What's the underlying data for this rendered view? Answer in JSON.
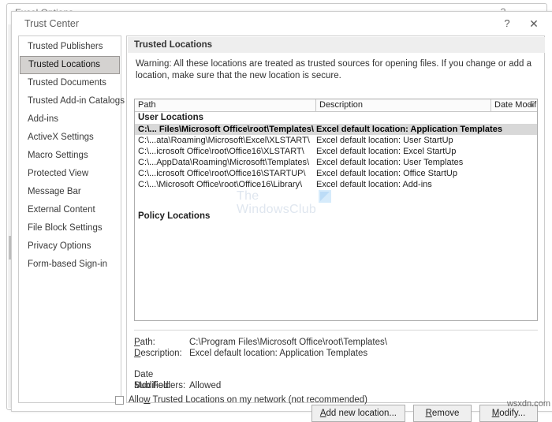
{
  "background_window": {
    "title": "Excel Options",
    "help_icon": "?",
    "minimize_icon": "⌄"
  },
  "dialog": {
    "title": "Trust Center",
    "help_icon": "?",
    "close_icon": "✕"
  },
  "sidebar": {
    "items": [
      {
        "label": "Trusted Publishers",
        "selected": false
      },
      {
        "label": "Trusted Locations",
        "selected": true
      },
      {
        "label": "Trusted Documents",
        "selected": false
      },
      {
        "label": "Trusted Add-in Catalogs",
        "selected": false
      },
      {
        "label": "Add-ins",
        "selected": false
      },
      {
        "label": "ActiveX Settings",
        "selected": false
      },
      {
        "label": "Macro Settings",
        "selected": false
      },
      {
        "label": "Protected View",
        "selected": false
      },
      {
        "label": "Message Bar",
        "selected": false
      },
      {
        "label": "External Content",
        "selected": false
      },
      {
        "label": "File Block Settings",
        "selected": false
      },
      {
        "label": "Privacy Options",
        "selected": false
      },
      {
        "label": "Form-based Sign-in",
        "selected": false
      }
    ]
  },
  "main": {
    "section_title": "Trusted Locations",
    "warning": "Warning: All these locations are treated as trusted sources for opening files.  If you change or add a location, make sure that the new location is secure.",
    "columns": {
      "path": "Path",
      "description": "Description",
      "date_modified": "Date Modified",
      "sort_icon": "sort-descending-arrow"
    },
    "groups": [
      {
        "label": "User Locations",
        "rows": [
          {
            "path": "C:\\... Files\\Microsoft Office\\root\\Templates\\",
            "description": "Excel default location: Application Templates",
            "selected": true
          },
          {
            "path": "C:\\...ata\\Roaming\\Microsoft\\Excel\\XLSTART\\",
            "description": "Excel default location: User StartUp",
            "selected": false
          },
          {
            "path": "C:\\...icrosoft Office\\root\\Office16\\XLSTART\\",
            "description": "Excel default location: Excel StartUp",
            "selected": false
          },
          {
            "path": "C:\\...AppData\\Roaming\\Microsoft\\Templates\\",
            "description": "Excel default location: User Templates",
            "selected": false
          },
          {
            "path": "C:\\...icrosoft Office\\root\\Office16\\STARTUP\\",
            "description": "Excel default location: Office StartUp",
            "selected": false
          },
          {
            "path": "C:\\...\\Microsoft Office\\root\\Office16\\Library\\",
            "description": "Excel default location: Add-ins",
            "selected": false
          }
        ]
      },
      {
        "label": "Policy Locations",
        "rows": []
      }
    ],
    "details": {
      "path_label": "Path:",
      "path_value": "C:\\Program Files\\Microsoft Office\\root\\Templates\\",
      "description_label": "Description:",
      "description_value": "Excel default location: Application Templates",
      "date_modified_label": "Date Modified:",
      "date_modified_value": "",
      "sub_folders_label": "Sub Folders:",
      "sub_folders_value": "Allowed"
    },
    "buttons": {
      "add": "Add new location...",
      "remove": "Remove",
      "modify": "Modify..."
    },
    "checkbox": {
      "label": "Allow Trusted Locations on my network (not recommended)",
      "checked": false
    }
  },
  "watermarks": {
    "club_line1": "The",
    "club_line2": "WindowsClub",
    "corner": "wsxdn.com"
  }
}
